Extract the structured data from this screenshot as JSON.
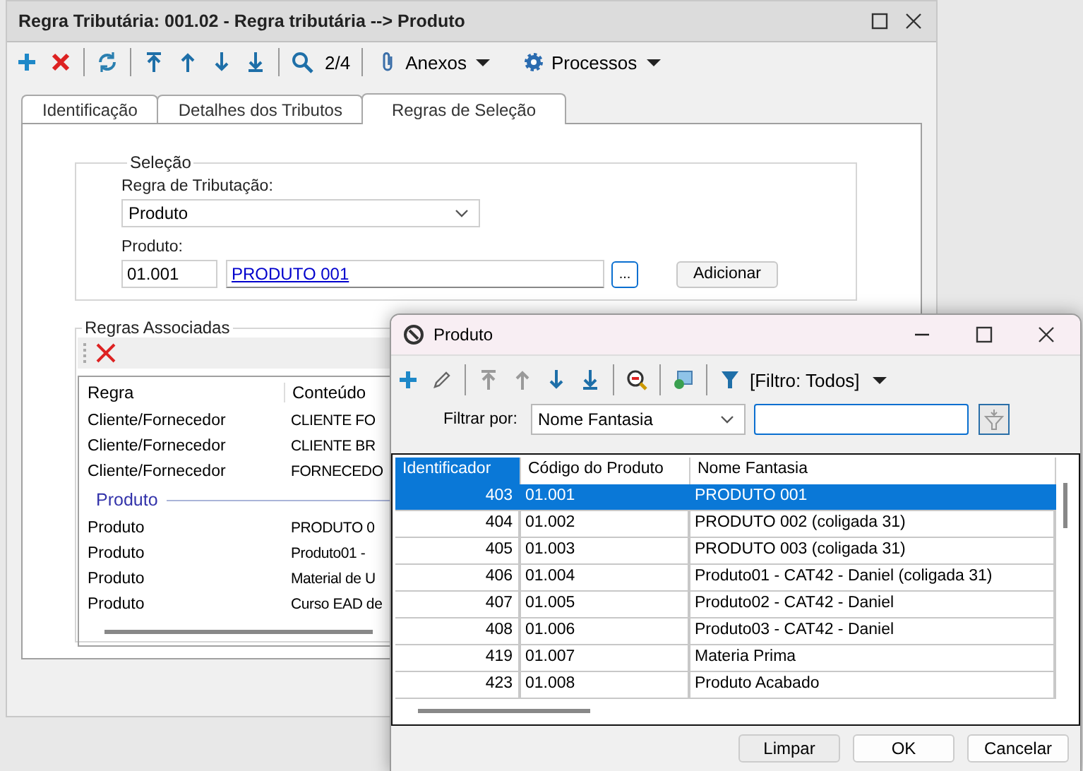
{
  "main_window": {
    "title": "Regra Tributária: 001.02 - Regra tributária --> Produto",
    "toolbar": {
      "record_position": "2/4",
      "menus": [
        {
          "label": "Anexos"
        },
        {
          "label": "Processos"
        }
      ]
    },
    "tabs": [
      {
        "label": "Identificação",
        "selected": false
      },
      {
        "label": "Detalhes dos Tributos",
        "selected": false
      },
      {
        "label": "Regras de Seleção",
        "selected": true
      }
    ],
    "selecao": {
      "title": "Seleção",
      "regra_label": "Regra de Tributação:",
      "regra_value": "Produto",
      "produto_label": "Produto:",
      "produto_code": "01.001",
      "produto_link": "PRODUTO 001",
      "browse_button": "...",
      "add_button": "Adicionar"
    },
    "regras_associadas": {
      "title": "Regras Associadas",
      "columns": [
        "Regra",
        "Conteúdo"
      ],
      "rows": [
        {
          "kind": "row",
          "regra": "Cliente/Fornecedor",
          "conteudo": "CLIENTE  FO"
        },
        {
          "kind": "row",
          "regra": "Cliente/Fornecedor",
          "conteudo": "CLIENTE BR"
        },
        {
          "kind": "row",
          "regra": "Cliente/Fornecedor",
          "conteudo": "FORNECEDO"
        },
        {
          "kind": "group",
          "label": "Produto"
        },
        {
          "kind": "row",
          "regra": "Produto",
          "conteudo": "PRODUTO 0"
        },
        {
          "kind": "row",
          "regra": "Produto",
          "conteudo": "Produto01 -"
        },
        {
          "kind": "row",
          "regra": "Produto",
          "conteudo": "Material de U"
        },
        {
          "kind": "row",
          "regra": "Produto",
          "conteudo": "Curso EAD de"
        }
      ]
    }
  },
  "dialog": {
    "title": "Produto",
    "filter_menu": "[Filtro: Todos]",
    "filter_label": "Filtrar por:",
    "filter_field": "Nome Fantasia",
    "columns": [
      "Identificador",
      "Código do Produto",
      "Nome Fantasia"
    ],
    "rows": [
      {
        "selected": true,
        "cells": [
          "403",
          "01.001",
          "PRODUTO 001"
        ]
      },
      {
        "selected": false,
        "cells": [
          "404",
          "01.002",
          "PRODUTO 002 (coligada 31)"
        ]
      },
      {
        "selected": false,
        "cells": [
          "405",
          "01.003",
          "PRODUTO 003 (coligada 31)"
        ]
      },
      {
        "selected": false,
        "cells": [
          "406",
          "01.004",
          "Produto01 -  CAT42 - Daniel (coligada 31)"
        ]
      },
      {
        "selected": false,
        "cells": [
          "407",
          "01.005",
          "Produto02 -  CAT42 - Daniel"
        ]
      },
      {
        "selected": false,
        "cells": [
          "408",
          "01.006",
          "Produto03 - CAT42 - Daniel"
        ]
      },
      {
        "selected": false,
        "cells": [
          "419",
          "01.007",
          "Materia Prima"
        ]
      },
      {
        "selected": false,
        "cells": [
          "423",
          "01.008",
          "Produto Acabado"
        ]
      }
    ],
    "buttons": [
      "Limpar",
      "OK",
      "Cancelar"
    ]
  }
}
